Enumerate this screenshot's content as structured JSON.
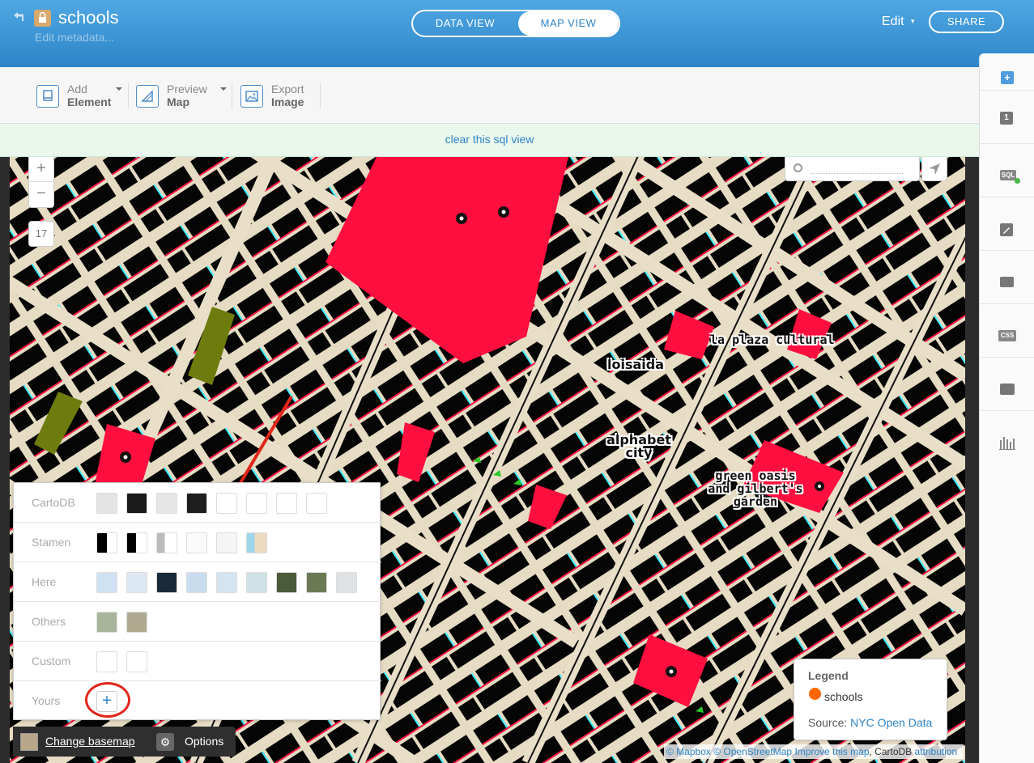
{
  "header": {
    "title": "schools",
    "subtitle": "Edit metadata...",
    "view_toggle": {
      "data_view": "DATA VIEW",
      "map_view": "MAP VIEW"
    },
    "edit_menu": "Edit",
    "share": "SHARE"
  },
  "toolbar": {
    "add_element": {
      "line1": "Add",
      "line2": "Element"
    },
    "preview_map": {
      "line1": "Preview",
      "line2": "Map"
    },
    "export_image": {
      "line1": "Export",
      "line2": "Image"
    }
  },
  "sql_bar": {
    "link": "clear this sql view"
  },
  "right_panel": {
    "items": [
      {
        "icon": "add-layer-icon",
        "text": "+"
      },
      {
        "icon": "layer-number-icon",
        "text": "1"
      },
      {
        "icon": "sql-icon",
        "text": "SQL"
      },
      {
        "icon": "wizard-icon",
        "text": ""
      },
      {
        "icon": "infowindow-icon",
        "text": ""
      },
      {
        "icon": "css-icon",
        "text": "CSS"
      },
      {
        "icon": "legend-icon",
        "text": ""
      },
      {
        "icon": "filters-icon",
        "text": ""
      }
    ]
  },
  "map": {
    "zoom_level": "17",
    "zoom_in": "+",
    "zoom_out": "−",
    "labels": {
      "la_plaza": "la plaza cultural",
      "loisaida": "loisaida",
      "alphabet_1": "alphabet",
      "alphabet_2": "city",
      "green_oasis_1": "green oasis",
      "green_oasis_2": "and gilbert's",
      "green_oasis_3": "garden"
    }
  },
  "basemap_chooser": {
    "rows": [
      {
        "label": "CartoDB"
      },
      {
        "label": "Stamen"
      },
      {
        "label": "Here"
      },
      {
        "label": "Others"
      },
      {
        "label": "Custom"
      },
      {
        "label": "Yours",
        "button": "+"
      }
    ]
  },
  "bottom_bar": {
    "change_basemap": "Change basemap",
    "options": "Options"
  },
  "legend": {
    "title": "Legend",
    "item": "schools",
    "item_color": "#ff6600",
    "source_prefix": "Source:",
    "source_link": "NYC Open Data"
  },
  "attribution": {
    "mapbox": "© Mapbox",
    "osm": "© OpenStreetMap",
    "improve": "Improve this map",
    "cartodb": ", CartoDB",
    "attribution": "attribution"
  },
  "colors": {
    "header": "#2d85c8",
    "accent": "#2d85c8",
    "park": "#ff0f3f",
    "building": "#000000",
    "annotation": "#e2261b"
  }
}
